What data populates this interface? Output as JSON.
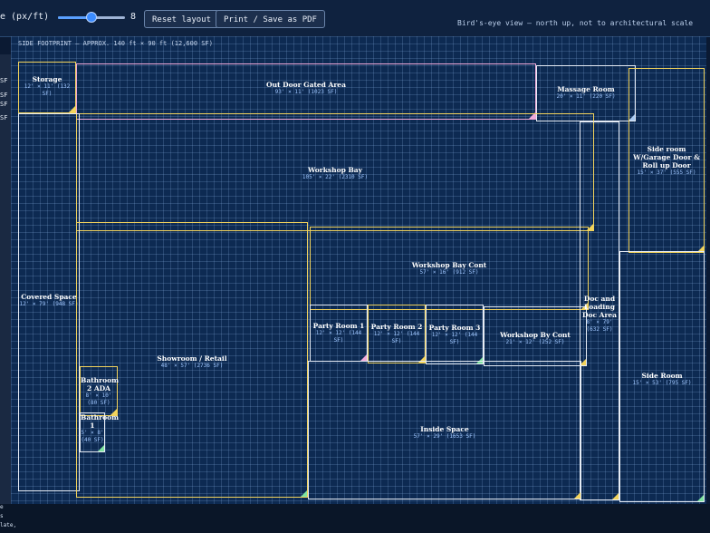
{
  "toolbar": {
    "zoom_label": "e (px/ft)",
    "zoom_value": "8",
    "zoom_fraction": 0.5,
    "reset_label": "Reset layout",
    "print_label": "Print / Save as PDF",
    "view_note": "Bird's-eye view — north up, not to architectural scale"
  },
  "plan": {
    "footprint": "SIDE FOOTPRINT — APPROX. 140 ft × 90 ft (12,600 SF)",
    "left_tags": [
      "SF",
      "SF",
      "SF",
      "SF"
    ],
    "bottom_tags": [
      "e",
      "s",
      "late,"
    ],
    "rooms": {
      "storage": {
        "name": "Storage",
        "dims": "12' × 11' (132 SF)"
      },
      "outdoor": {
        "name": "Out Door Gated Area",
        "dims": "93' × 11' (1023 SF)"
      },
      "massage": {
        "name": "Massage Room",
        "dims": "20' × 11' (220 SF)"
      },
      "sideroom_garage": {
        "name": "Side room W/Garage Door & Roll up Door",
        "dims": "15' × 37' (555 SF)"
      },
      "workshop_bay": {
        "name": "Workshop Bay",
        "dims": "105' × 22' (2310 SF)"
      },
      "covered_space": {
        "name": "Covered Space",
        "dims": "12' × 79' (948 SF)"
      },
      "workshop_bay_cont": {
        "name": "Workshop Bay Cont",
        "dims": "57' × 16' (912 SF)"
      },
      "party1": {
        "name": "Party Room 1",
        "dims": "12' × 12' (144 SF)"
      },
      "party2": {
        "name": "Party Room 2",
        "dims": "12' × 12' (144 SF)"
      },
      "party3": {
        "name": "Party Room 3",
        "dims": "12' × 12' (144 SF)"
      },
      "workshop_by_cont": {
        "name": "Workshop By Cont",
        "dims": "21' × 12' (252 SF)"
      },
      "doc_loading": {
        "name": "Doc and Loading Doc Area",
        "dims": "8' × 79' (632 SF)"
      },
      "showroom": {
        "name": "Showroom / Retail",
        "dims": "48' × 57' (2736 SF)"
      },
      "bath2": {
        "name": "Bathroom 2 ADA",
        "dims": "8' × 10' (80 SF)"
      },
      "bath1": {
        "name": "Bathroom 1",
        "dims": "5' × 8' (40 SF)"
      },
      "side_room": {
        "name": "Side Room",
        "dims": "15' × 53' (795 SF)"
      },
      "inside_space": {
        "name": "Inside Space",
        "dims": "57' × 29' (1653 SF)"
      }
    }
  }
}
